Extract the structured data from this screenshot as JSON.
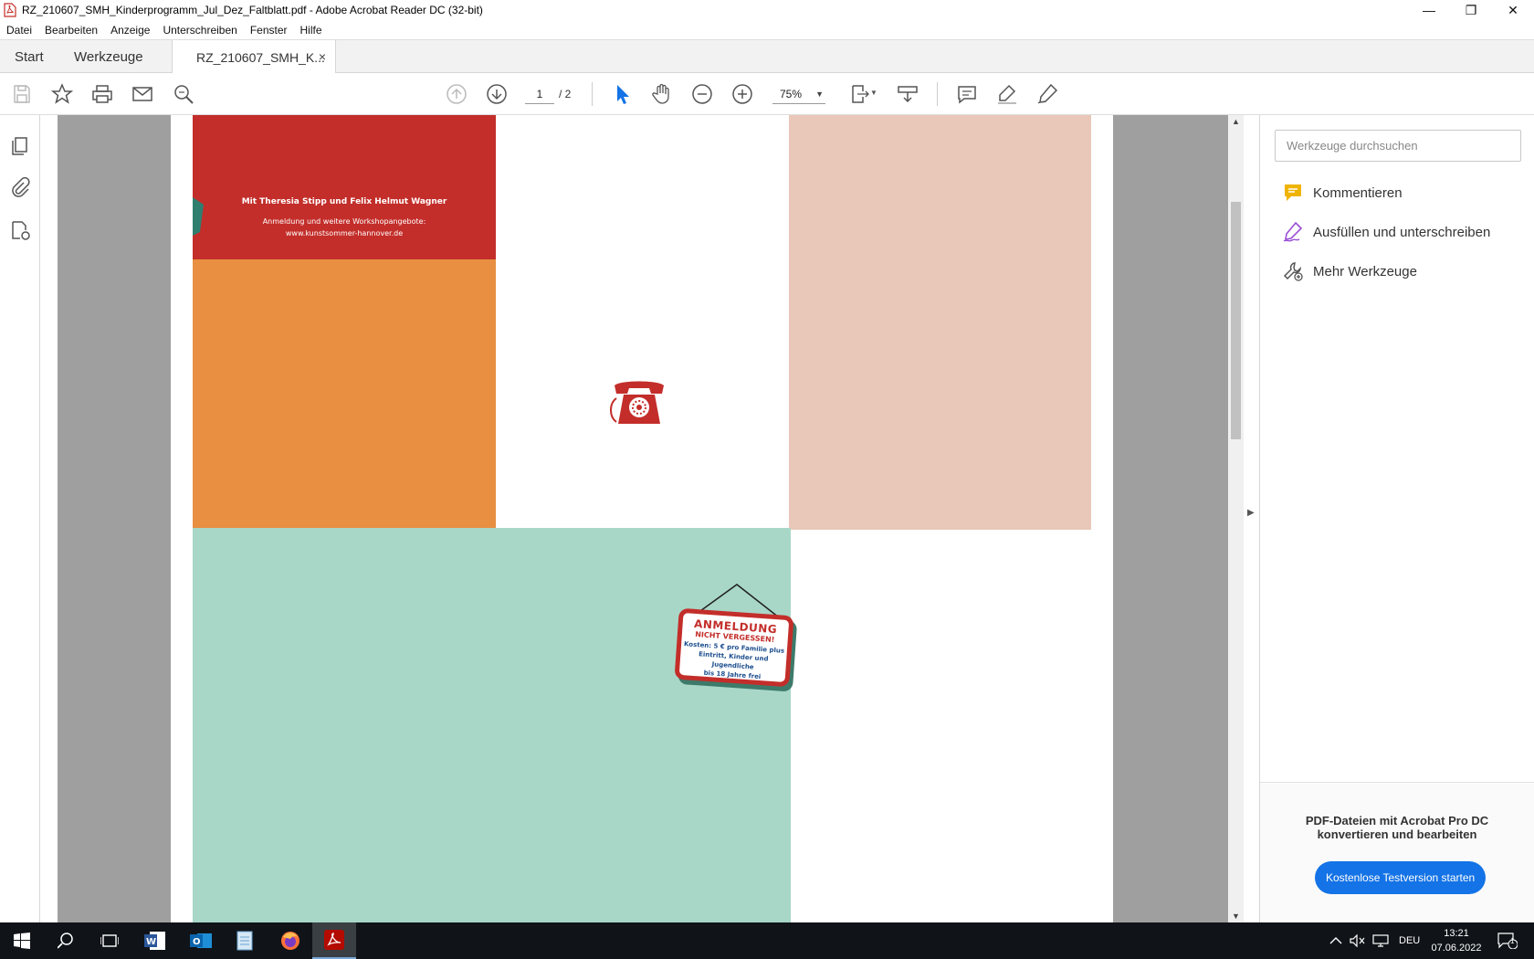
{
  "window": {
    "title": "RZ_210607_SMH_Kinderprogramm_Jul_Dez_Faltblatt.pdf - Adobe Acrobat Reader DC (32-bit)",
    "minimize": "—",
    "restore": "❐",
    "close": "✕"
  },
  "menu": [
    "Datei",
    "Bearbeiten",
    "Anzeige",
    "Unterschreiben",
    "Fenster",
    "Hilfe"
  ],
  "tabs": {
    "start": "Start",
    "tools": "Werkzeuge",
    "doc": "RZ_210607_SMH_K...",
    "close": "×"
  },
  "toolbar": {
    "page_current": "1",
    "page_total": "/ 2",
    "zoom": "75%",
    "zoom_caret": "▼"
  },
  "document": {
    "red_line1": "Mit Theresia Stipp und Felix Helmut Wagner",
    "red_line2": "Anmeldung und weitere Workshopangebote:",
    "red_line3": "www.kunstsommer-hannover.de",
    "sign_title": "ANMELDUNG",
    "sign_sub": "NICHT VERGESSEN!",
    "sign_body1": "Kosten: 5 € pro Familie plus",
    "sign_body2": "Eintritt, Kinder und Jugendliche",
    "sign_body3": "bis 18 Jahre frei"
  },
  "tools_pane": {
    "search_placeholder": "Werkzeuge durchsuchen",
    "items": [
      {
        "label": "Kommentieren",
        "icon": "comment-icon"
      },
      {
        "label": "Ausfüllen und unterschreiben",
        "icon": "fill-sign-icon"
      },
      {
        "label": "Mehr Werkzeuge",
        "icon": "more-tools-icon"
      }
    ],
    "promo_line1": "PDF-Dateien mit Acrobat Pro DC",
    "promo_line2": "konvertieren und bearbeiten",
    "promo_button": "Kostenlose Testversion starten"
  },
  "taskbar": {
    "lang": "DEU",
    "time": "13:21",
    "date": "07.06.2022",
    "notif_count": "1"
  },
  "colors": {
    "accent": "#1473e6",
    "red": "#c32e2a",
    "orange": "#e88f42",
    "pink": "#e9c8b9",
    "mint": "#a8d7c8"
  }
}
